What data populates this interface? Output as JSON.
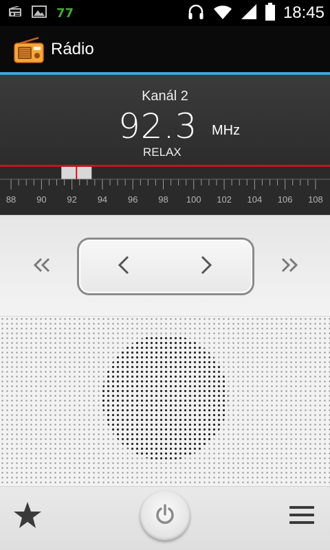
{
  "status_bar": {
    "notification_count": "77",
    "time": "18:45",
    "icons": [
      "radio-icon",
      "image-icon",
      "headphones-icon",
      "wifi-icon",
      "signal-icon",
      "battery-icon"
    ]
  },
  "app_bar": {
    "title": "Rádio",
    "accent_color": "#3aa9d8"
  },
  "display": {
    "channel": "Kanál 2",
    "frequency": "92.3",
    "unit": "MHz",
    "station": "RELAX",
    "indicator_color": "#c4161c"
  },
  "tuner": {
    "scale_labels": [
      "88",
      "90",
      "92",
      "94",
      "96",
      "98",
      "100",
      "102",
      "104",
      "106",
      "108"
    ],
    "range_mhz": [
      87.5,
      108.5
    ],
    "current_mhz": 92.3
  },
  "controls": {
    "icons": [
      "seek-back-icon",
      "step-back-icon",
      "step-forward-icon",
      "seek-forward-icon"
    ]
  },
  "bottom_bar": {
    "icons": [
      "favorites-star-icon",
      "power-icon",
      "menu-icon"
    ]
  }
}
